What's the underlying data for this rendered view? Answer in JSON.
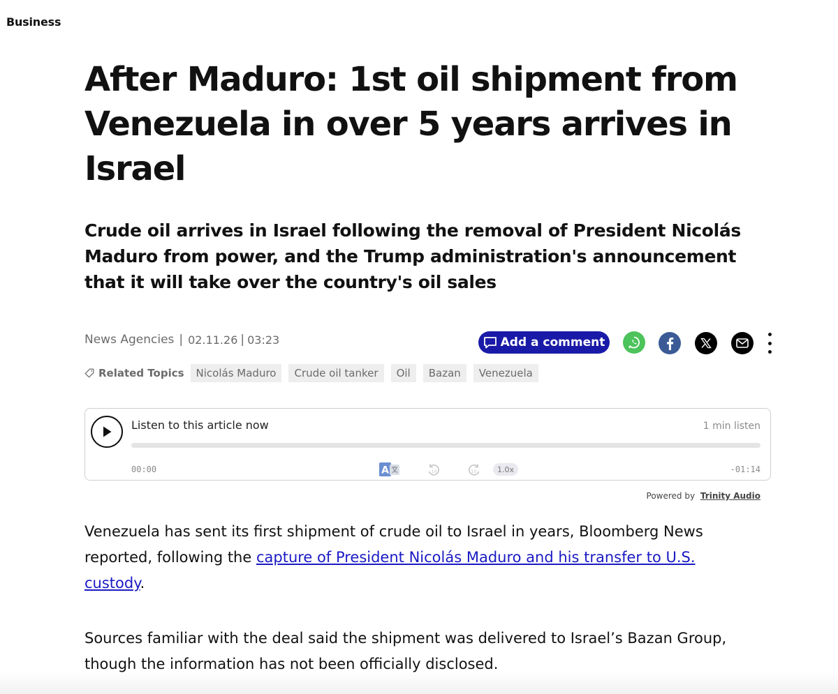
{
  "section": {
    "label": "Business"
  },
  "article": {
    "headline": "After Maduro: 1st oil shipment from Venezuela in over 5 years arrives in Israel",
    "subheadline": "Crude oil arrives in Israel following the removal of President Nicolás Maduro from power, and the Trump administration's announcement that it will take over the country's oil sales",
    "author": "News Agencies",
    "date": "02.11.26",
    "time": "03:23",
    "separator": "|"
  },
  "actions": {
    "comment_label": "Add a comment",
    "share_icons": [
      "whatsapp-icon",
      "facebook-icon",
      "x-icon",
      "email-icon"
    ],
    "more_icon": "more-vertical-icon"
  },
  "topics": {
    "label": "Related Topics",
    "items": [
      "Nicolás Maduro",
      "Crude oil tanker",
      "Oil",
      "Bazan",
      "Venezuela"
    ]
  },
  "audio_player": {
    "title": "Listen to this article now",
    "duration": "1 min listen",
    "current_time": "00:00",
    "remaining_time": "-01:14",
    "speed": "1.0x",
    "progress": 0,
    "powered_by_label": "Powered by",
    "powered_by_link": "Trinity Audio"
  },
  "body": {
    "p1_before": "Venezuela has sent its first shipment of crude oil to Israel in years, Bloomberg News reported, following the ",
    "p1_link": "capture of President Nicolás Maduro and his transfer to U.S. custody",
    "p1_after": ".",
    "p2": "Sources familiar with the deal said the shipment was delivered to Israel’s Bazan Group, though the information has not been officially disclosed."
  },
  "colors": {
    "comment_button": "#1a1aa8",
    "whatsapp": "#4cc35b",
    "facebook": "#3b5a96",
    "link": "#1a1ac4",
    "meta_text": "#6b6b6b"
  }
}
